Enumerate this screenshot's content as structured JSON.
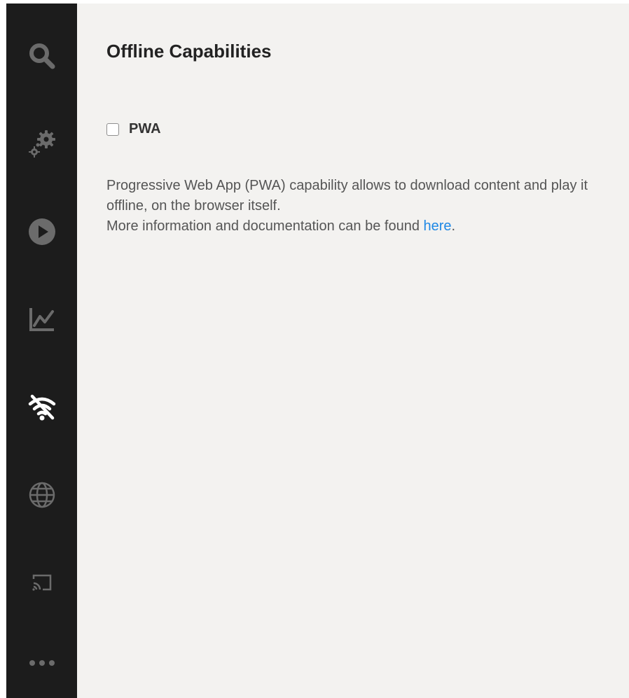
{
  "sidebar": {
    "items": [
      {
        "icon": "search-icon"
      },
      {
        "icon": "gears-icon"
      },
      {
        "icon": "play-icon"
      },
      {
        "icon": "chart-icon"
      },
      {
        "icon": "wifi-off-icon",
        "active": true
      },
      {
        "icon": "globe-icon"
      },
      {
        "icon": "cast-icon"
      },
      {
        "icon": "more-icon"
      }
    ],
    "icon_color": "#6b6b6b",
    "active_icon_color": "#ffffff"
  },
  "main": {
    "title": "Offline Capabilities",
    "pwa": {
      "label": "PWA",
      "checked": false
    },
    "description": {
      "line1": "Progressive Web App (PWA) capability allows to download content and play it offline, on the browser itself.",
      "line2_prefix": "More information and documentation can be found ",
      "link_text": "here",
      "line2_suffix": "."
    }
  },
  "colors": {
    "sidebar_bg": "#1c1c1c",
    "content_bg": "#f3f2f0",
    "link": "#1e88e5"
  }
}
